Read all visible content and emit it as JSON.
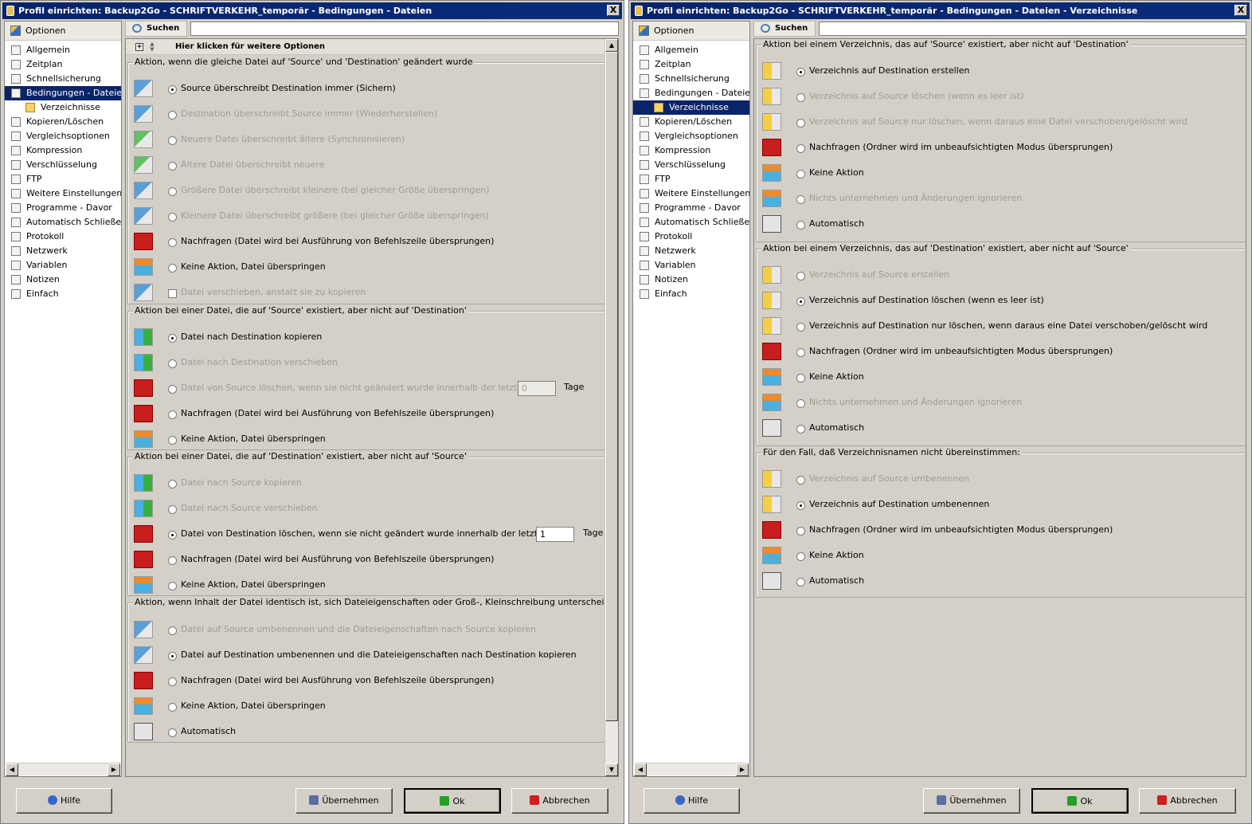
{
  "left": {
    "title": "Profil einrichten: Backup2Go - SCHRIFTVERKEHR_temporär - Bedingungen - Dateien",
    "close": "X",
    "sidebar_head": "Optionen",
    "nav": [
      "Allgemein",
      "Zeitplan",
      "Schnellsicherung",
      "Bedingungen - Dateien",
      "Verzeichnisse",
      "Kopieren/Löschen",
      "Vergleichsoptionen",
      "Kompression",
      "Verschlüsselung",
      "FTP",
      "Weitere Einstellungen",
      "Programme - Davor",
      "Automatisch Schließen",
      "Protokoll",
      "Netzwerk",
      "Variablen",
      "Notizen",
      "Einfach"
    ],
    "search_label": "Suchen",
    "more_options": "Hier klicken für weitere Optionen",
    "groups": [
      {
        "legend": "Aktion, wenn die gleiche Datei auf 'Source' und 'Destination' geändert wurde",
        "rows": [
          "Source überschreibt Destination immer (Sichern)",
          "Destination überschreibt Source immer (Wiederherstellen)",
          "Neuere Datei überschreibt ältere (Synchronisieren)",
          "Ältere Datei überschreibt neuere",
          "Größere Datei überschreibt kleinere (bei gleicher Größe überspringen)",
          "Kleinere Datei überschreibt größere (bei gleicher Größe überspringen)",
          "Nachfragen (Datei wird bei Ausführung von Befehlszeile übersprungen)",
          "Keine Aktion, Datei überspringen",
          "Datei verschieben, anstatt sie zu kopieren"
        ]
      },
      {
        "legend": "Aktion bei einer Datei, die auf 'Source' existiert, aber nicht auf 'Destination'",
        "rows": [
          "Datei nach Destination kopieren",
          "Datei nach Destination verschieben",
          "Datei von Source löschen, wenn sie nicht geändert wurde innerhalb der letzten",
          "Nachfragen (Datei wird bei Ausführung von Befehlszeile übersprungen)",
          "Keine Aktion, Datei überspringen"
        ],
        "days_value": "0",
        "days_unit": "Tage"
      },
      {
        "legend": "Aktion bei einer Datei, die auf 'Destination' existiert, aber nicht auf 'Source'",
        "rows": [
          "Datei nach Source kopieren",
          "Datei nach Source verschieben",
          "Datei von Destination löschen, wenn sie nicht geändert wurde innerhalb der letzten",
          "Nachfragen (Datei wird bei Ausführung von Befehlszeile übersprungen)",
          "Keine Aktion, Datei überspringen"
        ],
        "days_value": "1",
        "days_unit": "Tage"
      },
      {
        "legend": "Aktion, wenn Inhalt der Datei identisch ist, sich Dateieigenschaften oder Groß-, Kleinschreibung unterscheiden:",
        "rows": [
          "Datei auf Source umbenennen und die Dateieigenschaften nach Source kopieren",
          "Datei auf Destination umbenennen und die Dateieigenschaften nach Destination kopieren",
          "Nachfragen (Datei wird bei Ausführung von Befehlszeile übersprungen)",
          "Keine Aktion, Datei überspringen",
          "Automatisch"
        ]
      }
    ],
    "buttons": {
      "help": "Hilfe",
      "apply": "Übernehmen",
      "ok": "Ok",
      "cancel": "Abbrechen"
    }
  },
  "right": {
    "title": "Profil einrichten: Backup2Go - SCHRIFTVERKEHR_temporär - Bedingungen - Dateien - Verzeichnisse",
    "close": "X",
    "sidebar_head": "Optionen",
    "nav": [
      "Allgemein",
      "Zeitplan",
      "Schnellsicherung",
      "Bedingungen - Dateien",
      "Verzeichnisse",
      "Kopieren/Löschen",
      "Vergleichsoptionen",
      "Kompression",
      "Verschlüsselung",
      "FTP",
      "Weitere Einstellungen",
      "Programme - Davor",
      "Automatisch Schließen",
      "Protokoll",
      "Netzwerk",
      "Variablen",
      "Notizen",
      "Einfach"
    ],
    "search_label": "Suchen",
    "groups": [
      {
        "legend": "Aktion bei einem Verzeichnis, das auf 'Source' existiert, aber nicht auf 'Destination'",
        "rows": [
          "Verzeichnis auf Destination erstellen",
          "Verzeichnis auf Source löschen (wenn es leer ist)",
          "Verzeichnis auf Source nur löschen, wenn daraus eine Datei verschoben/gelöscht wird",
          "Nachfragen (Ordner wird im unbeaufsichtigten Modus übersprungen)",
          "Keine Aktion",
          "Nichts unternehmen und Änderungen ignorieren",
          "Automatisch"
        ]
      },
      {
        "legend": "Aktion bei einem Verzeichnis, das auf 'Destination' existiert, aber nicht auf 'Source'",
        "rows": [
          "Verzeichnis auf Source erstellen",
          "Verzeichnis auf Destination löschen (wenn es leer ist)",
          "Verzeichnis auf Destination nur löschen, wenn daraus eine Datei verschoben/gelöscht wird",
          "Nachfragen (Ordner wird im unbeaufsichtigten Modus übersprungen)",
          "Keine Aktion",
          "Nichts unternehmen und Änderungen ignorieren",
          "Automatisch"
        ]
      },
      {
        "legend": "Für den Fall, daß Verzeichnisnamen nicht übereinstimmen:",
        "rows": [
          "Verzeichnis auf Source umbenennen",
          "Verzeichnis auf Destination umbenennen",
          "Nachfragen (Ordner wird im unbeaufsichtigten Modus übersprungen)",
          "Keine Aktion",
          "Automatisch"
        ]
      }
    ],
    "buttons": {
      "help": "Hilfe",
      "apply": "Übernehmen",
      "ok": "Ok",
      "cancel": "Abbrechen"
    }
  }
}
